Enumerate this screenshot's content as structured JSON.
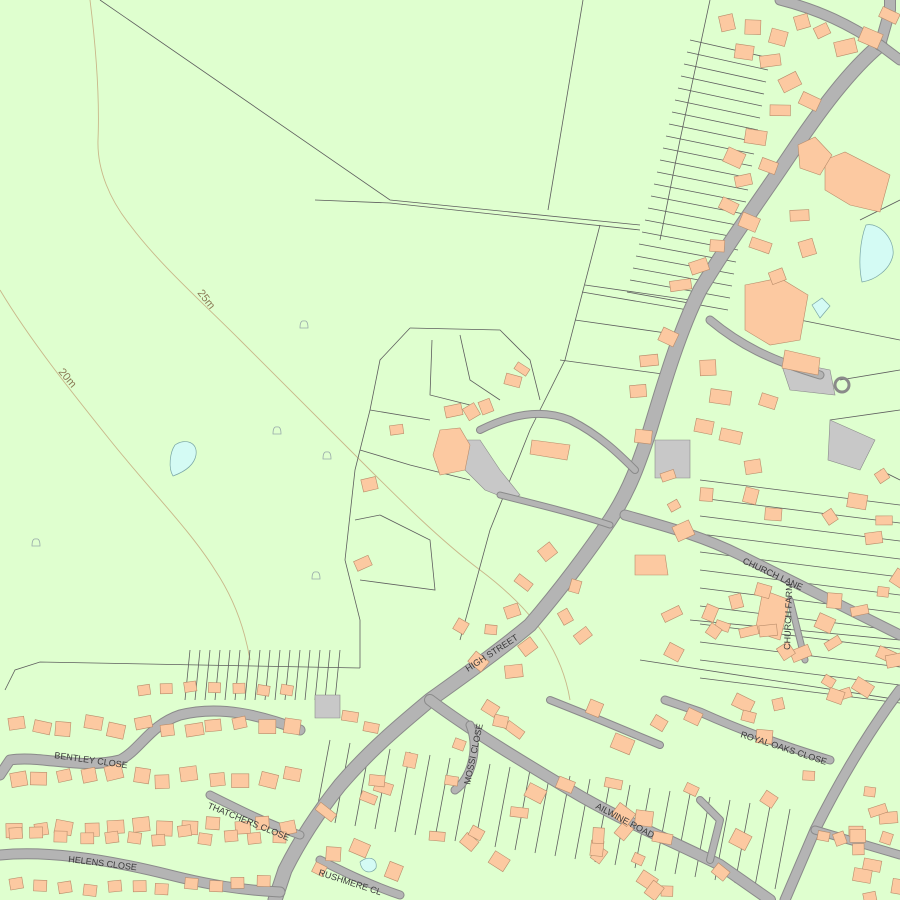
{
  "map": {
    "background_color": "#dfffcf",
    "building_color": "#fcc9a1",
    "road_color": "#b4b4b4",
    "water_color": "#d4fbf4",
    "contour_color": "#c9b78a",
    "street_labels": {
      "high_street": "HIGH STREET",
      "church_lane": "CHURCH LANE",
      "church_farm": "CHURCH FARM",
      "royal_oaks_close": "ROYAL OAKS CLOSE",
      "ailwine_road": "AILWINE ROAD",
      "mossi_close": "MOSSI CLOSE",
      "bentley_close": "BENTLEY CLOSE",
      "thatchers_close": "THATCHERS CLOSE",
      "helens_close": "HELENS CLOSE",
      "rushmere_cl": "RUSHMERE CL"
    },
    "contour_labels": {
      "c25": "25m",
      "c20": "20m"
    }
  }
}
